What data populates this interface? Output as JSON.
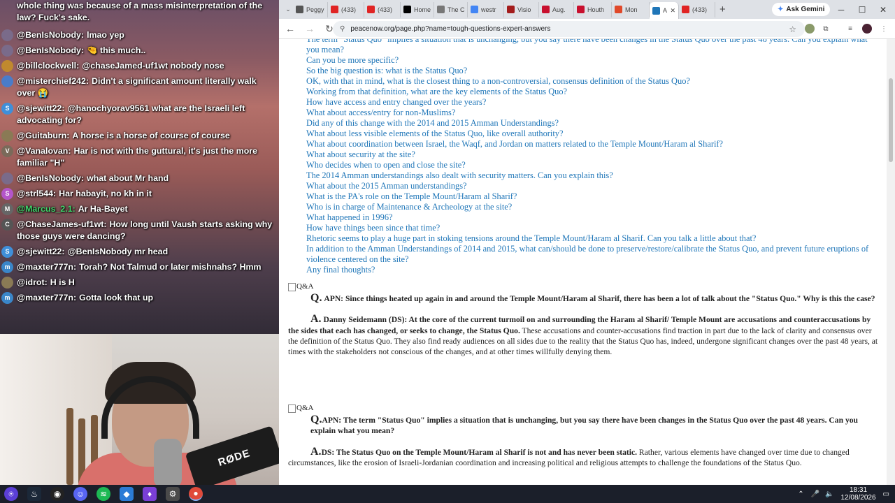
{
  "chat": {
    "messages": [
      {
        "user": "",
        "text": "whole thing was because of a mass misinterpretation of the law? Fuck's sake.",
        "avatar_color": ""
      },
      {
        "user": "@BenIsNobody:",
        "text": "lmao yep",
        "avatar_color": "#7a6b8a"
      },
      {
        "user": "@BenIsNobody:",
        "text": "🤏 this much..",
        "avatar_color": "#7a6b8a"
      },
      {
        "user": "@billclockwell:",
        "text": "@chaseJamed-uf1wt nobody nose",
        "avatar_color": "#c0892e"
      },
      {
        "user": "@misterchief242:",
        "text": "Didn't a significant amount literally walk over 😭",
        "avatar_color": "#4a7cc9"
      },
      {
        "user": "@sjewitt22:",
        "text": "@hanochyorav9561 what are the Israeli left advocating for?",
        "avatar_color": "#3f8fd9",
        "avatar_letter": "S"
      },
      {
        "user": "@Guitaburn:",
        "text": "A horse is a horse of course of course",
        "avatar_color": "#8a7a55"
      },
      {
        "user": "@Vanalovan:",
        "text": "Har is not with the guttural, it's just the more familiar \"H\"",
        "avatar_color": "#7a6a5a",
        "avatar_letter": "V"
      },
      {
        "user": "@BenIsNobody:",
        "text": "what about Mr hand",
        "avatar_color": "#7a6b8a"
      },
      {
        "user": "@strl544:",
        "text": "Har habayit, no kh in it",
        "avatar_color": "#b455c9",
        "avatar_letter": "S"
      },
      {
        "user": "@Marcus_2.1:",
        "text": "Ar Ha-Bayet",
        "avatar_color": "#666",
        "avatar_letter": "M",
        "user_color": "#3fd46a"
      },
      {
        "user": "@ChaseJames-uf1wt:",
        "text": "How long until Vaush starts asking why those guys were dancing?",
        "avatar_color": "#555",
        "avatar_letter": "C"
      },
      {
        "user": "@sjewitt22:",
        "text": "@BenIsNobody mr head",
        "avatar_color": "#3f8fd9",
        "avatar_letter": "S"
      },
      {
        "user": "@maxter777n:",
        "text": "Torah? Not Talmud or later mishnahs? Hmm",
        "avatar_color": "#3a86c9",
        "avatar_letter": "m"
      },
      {
        "user": "@idrot:",
        "text": "H is H",
        "avatar_color": "#8a7a55"
      },
      {
        "user": "@maxter777n:",
        "text": "Gotta look that up",
        "avatar_color": "#3a86c9",
        "avatar_letter": "m"
      }
    ]
  },
  "cam": {
    "mic_brand": "RØDE"
  },
  "browser": {
    "tabs": [
      {
        "label": "Peggy",
        "fav_color": "#555"
      },
      {
        "label": "(433)",
        "fav_color": "#e02424"
      },
      {
        "label": "(433)",
        "fav_color": "#e02424"
      },
      {
        "label": "Home",
        "fav_color": "#000"
      },
      {
        "label": "The C",
        "fav_color": "#777"
      },
      {
        "label": "westr",
        "fav_color": "#4285f4"
      },
      {
        "label": "Visio",
        "fav_color": "#a31c1c"
      },
      {
        "label": "Aug.",
        "fav_color": "#c8102e"
      },
      {
        "label": "Houth",
        "fav_color": "#c8102e"
      },
      {
        "label": "Mon",
        "fav_color": "#e0492a"
      },
      {
        "label": "A",
        "fav_color": "#1f76b8"
      },
      {
        "label": "(433)",
        "fav_color": "#e02424"
      }
    ],
    "gemini_label": "Ask Gemini",
    "url": "peacenow.org/page.php?name=tough-questions-expert-answers"
  },
  "page": {
    "links": [
      "The term \"Status Quo\" implies a situation that is unchanging, but you say there have been changes in the Status Quo over the past 48 years. Can you explain what you mean?",
      "Can you be more specific?",
      "So the big question is: what is the Status Quo?",
      "OK, with that in mind, what is the closest thing to a non-controversial, consensus definition of the Status Quo?",
      "Working from that definition, what are the key elements of the Status Quo?",
      "How have access and entry changed over the years?",
      "What about access/entry for non-Muslims?",
      "Did any of this change with the 2014 and 2015 Amman Understandings?",
      "What about less visible elements of the Status Quo, like overall authority?",
      "What about coordination between Israel, the Waqf, and Jordan on matters related to the Temple Mount/Haram al Sharif?",
      "What about security at the site?",
      "Who decides when to open and close the site?",
      "The 2014 Amman understandings also dealt with security matters. Can you explain this?",
      "What about the 2015 Amman understandings?",
      "What is the PA's role on the Temple Mount/Haram al Sharif?",
      "Who is in charge of Maintenance & Archeology at the site?",
      "What happened in 1996?",
      "How have things been since that time?",
      "Rhetoric seems to play a huge part in stoking tensions around the Temple Mount/Haram al Sharif. Can you talk a little about that?",
      "In addition to the Amman Understandings of 2014 and 2015, what can/should be done to preserve/restore/calibrate the Status Quo, and prevent future eruptions of violence centered on the site?",
      "Any final thoughts?"
    ],
    "qa_img_alt": "Q&A",
    "q1_letter": "Q.",
    "q1_text": "APN: Since things heated up again in and around the Temple Mount/Haram al Sharif, there has been a lot of talk about the \"Status Quo.\" Why is this the case?",
    "a1_letter": "A.",
    "a1_bold": "Danny Seidemann (DS): At the core of the current turmoil on and surrounding the Haram al Sharif/ Temple Mount are accusations and counteraccusations by the sides that each has changed, or seeks to change, the Status Quo.",
    "a1_text": " These accusations and counter-accusations find traction in part due to the lack of clarity and consensus over the definition of the Status Quo. They also find ready audiences on all sides due to the reality that the Status Quo has, indeed, undergone significant changes over the past 48 years, at times with the stakeholders not conscious of the changes, and at other times willfully denying them.",
    "q2_letter": "Q.",
    "q2_text": "APN: The term \"Status Quo\" implies a situation that is unchanging, but you say there have been changes in the Status Quo over the past 48 years. Can you explain what you mean?",
    "a2_letter": "A.",
    "a2_bold": "DS: The Status Quo on the Temple Mount/Haram al Sharif is not and has never been static.",
    "a2_text": " Rather, various elements have changed over time due to changed circumstances, like the erosion of Israeli-Jordanian coordination and increasing political and religious attempts to challenge the foundations of the Status Quo."
  },
  "tray": {
    "time": "18:31",
    "date": "12/08/2026"
  }
}
